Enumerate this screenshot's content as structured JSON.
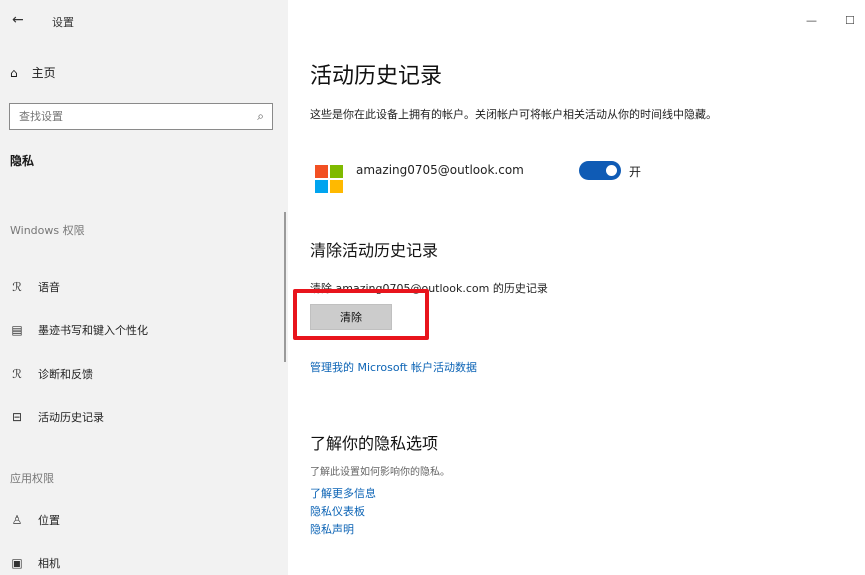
{
  "window": {
    "title": "设置",
    "back_icon": "←",
    "minimize_icon": "—",
    "maximize_icon": "☐"
  },
  "sidebar": {
    "home_label": "主页",
    "home_icon": "⌂",
    "search_placeholder": "查找设置",
    "search_icon": "⌕",
    "category_title": "隐私",
    "group_windows": "Windows 权限",
    "group_app": "应用权限",
    "items": [
      {
        "label": "语音",
        "icon": "ℛ"
      },
      {
        "label": "墨迹书写和键入个性化",
        "icon": "▤"
      },
      {
        "label": "诊断和反馈",
        "icon": "ℛ"
      },
      {
        "label": "活动历史记录",
        "icon": "⊟"
      },
      {
        "label": "位置",
        "icon": "♙"
      },
      {
        "label": "相机",
        "icon": "▣"
      }
    ]
  },
  "main": {
    "page_title": "活动历史记录",
    "description": "这些是你在此设备上拥有的帐户。关闭帐户可将帐户相关活动从你的时间线中隐藏。",
    "account": {
      "email": "amazing0705@outlook.com",
      "toggle_state": "开",
      "toggle_on": true
    },
    "clear_section": {
      "title": "清除活动历史记录",
      "text": "清除 amazing0705@outlook.com 的历史记录",
      "button_label": "清除"
    },
    "manage_link": "管理我的 Microsoft 帐户活动数据",
    "privacy_section": {
      "title": "了解你的隐私选项",
      "description": "了解此设置如何影响你的隐私。",
      "links": [
        "了解更多信息",
        "隐私仪表板",
        "隐私声明"
      ]
    }
  },
  "colors": {
    "accent": "#0f5bb5",
    "link": "#0b63b5",
    "highlight": "#e8141c",
    "ms_red": "#f25022",
    "ms_green": "#7fba00",
    "ms_blue": "#00a4ef",
    "ms_yellow": "#ffb900"
  }
}
